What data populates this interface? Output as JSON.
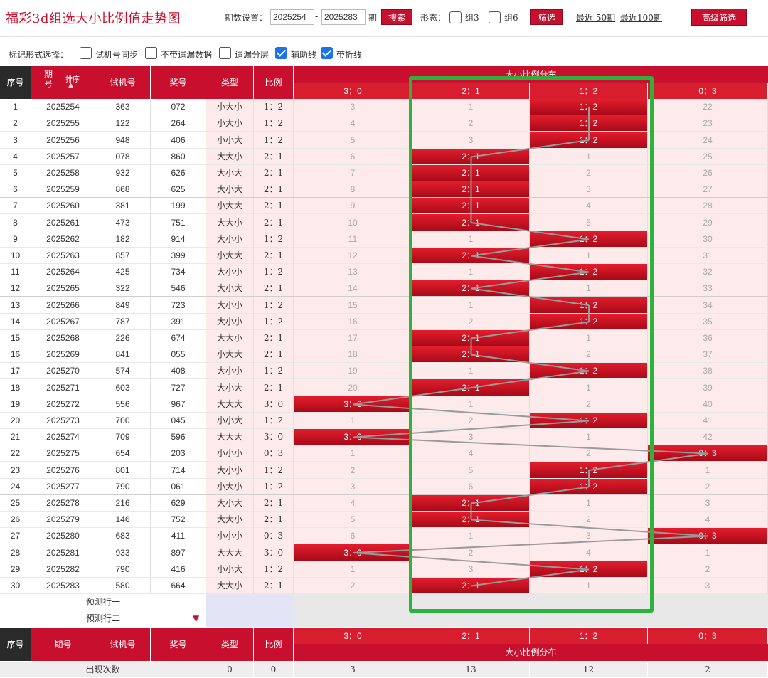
{
  "app": {
    "title": "福彩3d组选大小比例值走势图"
  },
  "query": {
    "label": "期数设置：",
    "from_value": "2025254",
    "to_value": "2025283",
    "unit": "期",
    "search_label": "搜索"
  },
  "form": {
    "label": "形态：",
    "group3_label": "组3",
    "group6_label": "组6",
    "filter_label": "筛选",
    "recent50_label": "最近 50期",
    "recent100_label": "最近100期",
    "advanced_label": "高级筛选"
  },
  "marks": {
    "label": "标记形式选择：",
    "options": [
      {
        "label": "试机号同步",
        "checked": false
      },
      {
        "label": "不带遗漏数据",
        "checked": false
      },
      {
        "label": "遗漏分层",
        "checked": false
      },
      {
        "label": "辅助线",
        "checked": true
      },
      {
        "label": "带折线",
        "checked": true
      }
    ]
  },
  "table": {
    "headers": {
      "seq": "序号",
      "period": "期号",
      "sort_label": "排序",
      "trial": "试机号",
      "prize": "奖号",
      "type": "类型",
      "ratio": "比例",
      "dist_title": "大小比例分布"
    },
    "dist_columns": [
      "3：0",
      "2：1",
      "1：2",
      "0：3"
    ],
    "rows": [
      {
        "seq": "1",
        "period": "2025254",
        "trial": "363",
        "prize": "072",
        "type": "小大小",
        "ratio": "1：2",
        "dist": [
          "3",
          "1",
          "1：2",
          "22"
        ],
        "hit": 2
      },
      {
        "seq": "2",
        "period": "2025255",
        "trial": "122",
        "prize": "264",
        "type": "小大小",
        "ratio": "1：2",
        "dist": [
          "4",
          "2",
          "1：2",
          "23"
        ],
        "hit": 2
      },
      {
        "seq": "3",
        "period": "2025256",
        "trial": "948",
        "prize": "406",
        "type": "小小大",
        "ratio": "1：2",
        "dist": [
          "5",
          "3",
          "1：2",
          "24"
        ],
        "hit": 2
      },
      {
        "seq": "4",
        "period": "2025257",
        "trial": "078",
        "prize": "860",
        "type": "大大小",
        "ratio": "2：1",
        "dist": [
          "6",
          "2：1",
          "1",
          "25"
        ],
        "hit": 1
      },
      {
        "seq": "5",
        "period": "2025258",
        "trial": "932",
        "prize": "626",
        "type": "大小大",
        "ratio": "2：1",
        "dist": [
          "7",
          "2：1",
          "2",
          "26"
        ],
        "hit": 1
      },
      {
        "seq": "6",
        "period": "2025259",
        "trial": "868",
        "prize": "625",
        "type": "大小大",
        "ratio": "2：1",
        "dist": [
          "8",
          "2：1",
          "3",
          "27"
        ],
        "hit": 1
      },
      {
        "seq": "7",
        "period": "2025260",
        "trial": "381",
        "prize": "199",
        "type": "小大大",
        "ratio": "2：1",
        "dist": [
          "9",
          "2：1",
          "4",
          "28"
        ],
        "hit": 1
      },
      {
        "seq": "8",
        "period": "2025261",
        "trial": "473",
        "prize": "751",
        "type": "大大小",
        "ratio": "2：1",
        "dist": [
          "10",
          "2：1",
          "5",
          "29"
        ],
        "hit": 1
      },
      {
        "seq": "9",
        "period": "2025262",
        "trial": "182",
        "prize": "914",
        "type": "大小小",
        "ratio": "1：2",
        "dist": [
          "11",
          "1",
          "1：2",
          "30"
        ],
        "hit": 2
      },
      {
        "seq": "10",
        "period": "2025263",
        "trial": "857",
        "prize": "399",
        "type": "小大大",
        "ratio": "2：1",
        "dist": [
          "12",
          "2：1",
          "1",
          "31"
        ],
        "hit": 1
      },
      {
        "seq": "11",
        "period": "2025264",
        "trial": "425",
        "prize": "734",
        "type": "大小小",
        "ratio": "1：2",
        "dist": [
          "13",
          "1",
          "1：2",
          "32"
        ],
        "hit": 2
      },
      {
        "seq": "12",
        "period": "2025265",
        "trial": "322",
        "prize": "546",
        "type": "大小大",
        "ratio": "2：1",
        "dist": [
          "14",
          "2：1",
          "1",
          "33"
        ],
        "hit": 1
      },
      {
        "seq": "13",
        "period": "2025266",
        "trial": "849",
        "prize": "723",
        "type": "大小小",
        "ratio": "1：2",
        "dist": [
          "15",
          "1",
          "1：2",
          "34"
        ],
        "hit": 2
      },
      {
        "seq": "14",
        "period": "2025267",
        "trial": "787",
        "prize": "391",
        "type": "大小小",
        "ratio": "1：2",
        "dist": [
          "16",
          "2",
          "1：2",
          "35"
        ],
        "hit": 2
      },
      {
        "seq": "15",
        "period": "2025268",
        "trial": "226",
        "prize": "674",
        "type": "大大小",
        "ratio": "2：1",
        "dist": [
          "17",
          "2：1",
          "1",
          "36"
        ],
        "hit": 1
      },
      {
        "seq": "16",
        "period": "2025269",
        "trial": "841",
        "prize": "055",
        "type": "小大大",
        "ratio": "2：1",
        "dist": [
          "18",
          "2：1",
          "2",
          "37"
        ],
        "hit": 1
      },
      {
        "seq": "17",
        "period": "2025270",
        "trial": "574",
        "prize": "408",
        "type": "大小小",
        "ratio": "1：2",
        "dist": [
          "19",
          "1",
          "1：2",
          "38"
        ],
        "hit": 2
      },
      {
        "seq": "18",
        "period": "2025271",
        "trial": "603",
        "prize": "727",
        "type": "大小大",
        "ratio": "2：1",
        "dist": [
          "20",
          "2：1",
          "1",
          "39"
        ],
        "hit": 1
      },
      {
        "seq": "19",
        "period": "2025272",
        "trial": "556",
        "prize": "967",
        "type": "大大大",
        "ratio": "3：0",
        "dist": [
          "3：0",
          "1",
          "2",
          "40"
        ],
        "hit": 0
      },
      {
        "seq": "20",
        "period": "2025273",
        "trial": "700",
        "prize": "045",
        "type": "小小大",
        "ratio": "1：2",
        "dist": [
          "1",
          "2",
          "1：2",
          "41"
        ],
        "hit": 2
      },
      {
        "seq": "21",
        "period": "2025274",
        "trial": "709",
        "prize": "596",
        "type": "大大大",
        "ratio": "3：0",
        "dist": [
          "3：0",
          "3",
          "1",
          "42"
        ],
        "hit": 0
      },
      {
        "seq": "22",
        "period": "2025275",
        "trial": "654",
        "prize": "203",
        "type": "小小小",
        "ratio": "0：3",
        "dist": [
          "1",
          "4",
          "2",
          "0：3"
        ],
        "hit": 3
      },
      {
        "seq": "23",
        "period": "2025276",
        "trial": "801",
        "prize": "714",
        "type": "大小小",
        "ratio": "1：2",
        "dist": [
          "2",
          "5",
          "1：2",
          "1"
        ],
        "hit": 2
      },
      {
        "seq": "24",
        "period": "2025277",
        "trial": "790",
        "prize": "061",
        "type": "小大小",
        "ratio": "1：2",
        "dist": [
          "3",
          "6",
          "1：2",
          "2"
        ],
        "hit": 2
      },
      {
        "seq": "25",
        "period": "2025278",
        "trial": "216",
        "prize": "629",
        "type": "大小大",
        "ratio": "2：1",
        "dist": [
          "4",
          "2：1",
          "1",
          "3"
        ],
        "hit": 1
      },
      {
        "seq": "26",
        "period": "2025279",
        "trial": "146",
        "prize": "752",
        "type": "大大小",
        "ratio": "2：1",
        "dist": [
          "5",
          "2：1",
          "2",
          "4"
        ],
        "hit": 1
      },
      {
        "seq": "27",
        "period": "2025280",
        "trial": "683",
        "prize": "411",
        "type": "小小小",
        "ratio": "0：3",
        "dist": [
          "6",
          "1",
          "3",
          "0：3"
        ],
        "hit": 3
      },
      {
        "seq": "28",
        "period": "2025281",
        "trial": "933",
        "prize": "897",
        "type": "大大大",
        "ratio": "3：0",
        "dist": [
          "3：0",
          "2",
          "4",
          "1"
        ],
        "hit": 0
      },
      {
        "seq": "29",
        "period": "2025282",
        "trial": "790",
        "prize": "416",
        "type": "小小大",
        "ratio": "1：2",
        "dist": [
          "1",
          "3",
          "1：2",
          "2"
        ],
        "hit": 2
      },
      {
        "seq": "30",
        "period": "2025283",
        "trial": "580",
        "prize": "664",
        "type": "大大小",
        "ratio": "2：1",
        "dist": [
          "2",
          "2：1",
          "1",
          "3"
        ],
        "hit": 1
      }
    ],
    "predict": {
      "row1": "预测行一",
      "row2": "预测行二"
    },
    "stats": {
      "label": "出现次数",
      "type_count": "0",
      "ratio_count": "0",
      "dist_counts": [
        "3",
        "13",
        "12",
        "2"
      ]
    }
  },
  "colors": {
    "accent": "#c8102e",
    "highlight_box": "#2db33d",
    "miss_bg": "#fdeaea"
  }
}
